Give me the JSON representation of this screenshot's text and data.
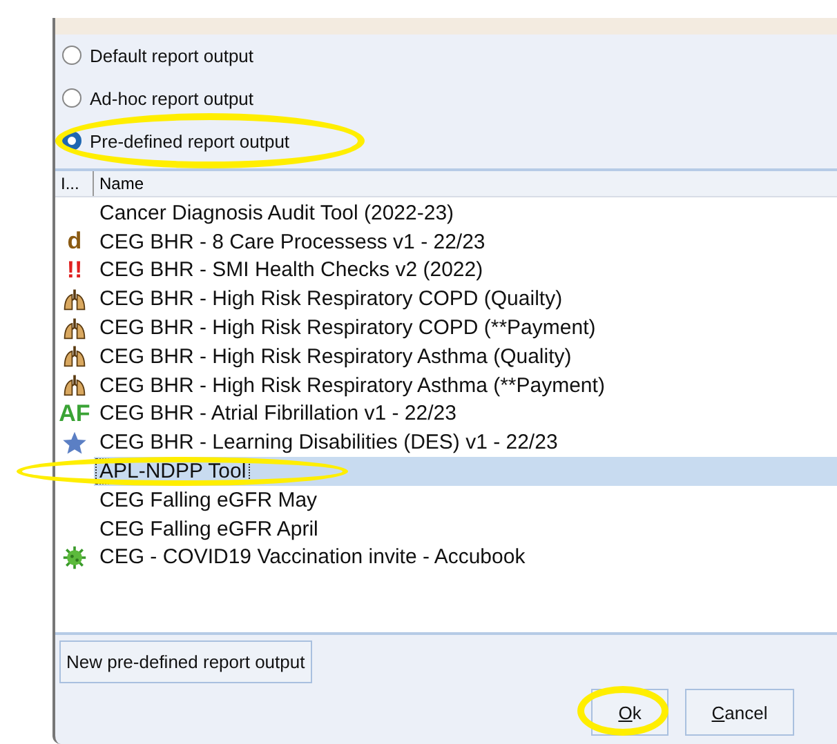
{
  "output_options": [
    {
      "label": "Default report output",
      "selected": false,
      "highlighted": false
    },
    {
      "label": "Ad-hoc report output",
      "selected": false,
      "highlighted": false
    },
    {
      "label": "Pre-defined report output",
      "selected": true,
      "highlighted": true
    }
  ],
  "list": {
    "columns": [
      "I...",
      "Name"
    ],
    "rows": [
      {
        "name": "Cancer Diagnosis Audit Tool (2022-23)",
        "selected": false,
        "highlighted": false
      },
      {
        "name": "CEG BHR - 8 Care Processess v1 - 22/23",
        "selected": false,
        "highlighted": false,
        "icon": {
          "kind": "glyph",
          "text": "d",
          "color": "#8a5a12"
        }
      },
      {
        "name": "CEG BHR - SMI Health Checks v2 (2022)",
        "selected": false,
        "highlighted": false,
        "icon": {
          "kind": "glyph",
          "text": "!!",
          "color": "#e02020"
        }
      },
      {
        "name": "CEG BHR - High Risk Respiratory COPD (Quailty)",
        "selected": false,
        "highlighted": false,
        "icon": {
          "kind": "lungs"
        }
      },
      {
        "name": "CEG BHR - High Risk Respiratory COPD (**Payment)",
        "selected": false,
        "highlighted": false,
        "icon": {
          "kind": "lungs"
        }
      },
      {
        "name": "CEG BHR - High Risk Respiratory Asthma (Quality)",
        "selected": false,
        "highlighted": false,
        "icon": {
          "kind": "lungs"
        }
      },
      {
        "name": "CEG BHR - High Risk Respiratory Asthma (**Payment)",
        "selected": false,
        "highlighted": false,
        "icon": {
          "kind": "lungs"
        }
      },
      {
        "name": "CEG BHR - Atrial Fibrillation v1 - 22/23",
        "selected": false,
        "highlighted": false,
        "icon": {
          "kind": "glyph",
          "text": "AF",
          "color": "#3aa335"
        }
      },
      {
        "name": "CEG BHR - Learning Disabilities (DES) v1 - 22/23",
        "selected": false,
        "highlighted": false,
        "icon": {
          "kind": "star"
        }
      },
      {
        "name": "APL-NDPP Tool",
        "selected": true,
        "highlighted": true
      },
      {
        "name": "CEG Falling eGFR May",
        "selected": false,
        "highlighted": false
      },
      {
        "name": "CEG Falling eGFR April",
        "selected": false,
        "highlighted": false
      },
      {
        "name": "CEG - COVID19 Vaccination invite - Accubook",
        "selected": false,
        "highlighted": false,
        "icon": {
          "kind": "virus"
        }
      }
    ]
  },
  "new_button": "New pre-defined report output",
  "buttons": [
    {
      "label": "Ok",
      "highlighted": true
    },
    {
      "label": "Cancel",
      "highlighted": false
    }
  ]
}
